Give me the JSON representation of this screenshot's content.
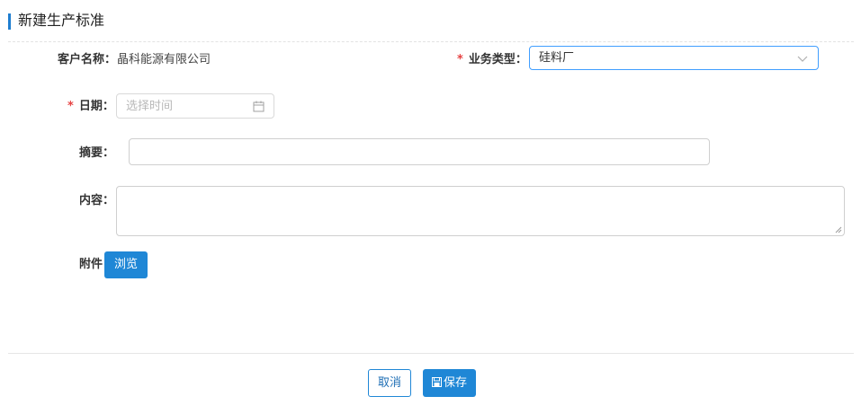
{
  "header": {
    "title": "新建生产标准"
  },
  "form": {
    "customer": {
      "label": "客户名称：",
      "value": "晶科能源有限公司"
    },
    "business_type": {
      "required_mark": "*",
      "label": "业务类型：",
      "value": "硅料厂"
    },
    "date": {
      "required_mark": "*",
      "label": "日期：",
      "placeholder": "选择时间"
    },
    "summary": {
      "label": "摘要：",
      "value": ""
    },
    "content": {
      "label": "内容：",
      "value": ""
    },
    "attachment": {
      "label": "附件",
      "browse_label": "浏览"
    }
  },
  "footer": {
    "cancel_label": "取消",
    "save_label": "保存"
  },
  "colors": {
    "accent": "#1f87d6",
    "required": "#e64242",
    "focus_border": "#409eff"
  },
  "icons": {
    "header_marker": "header-bar",
    "select_arrow": "chevron-down-icon",
    "date_picker": "calendar-icon",
    "save": "save-icon",
    "resize": "resize-grip-icon"
  }
}
